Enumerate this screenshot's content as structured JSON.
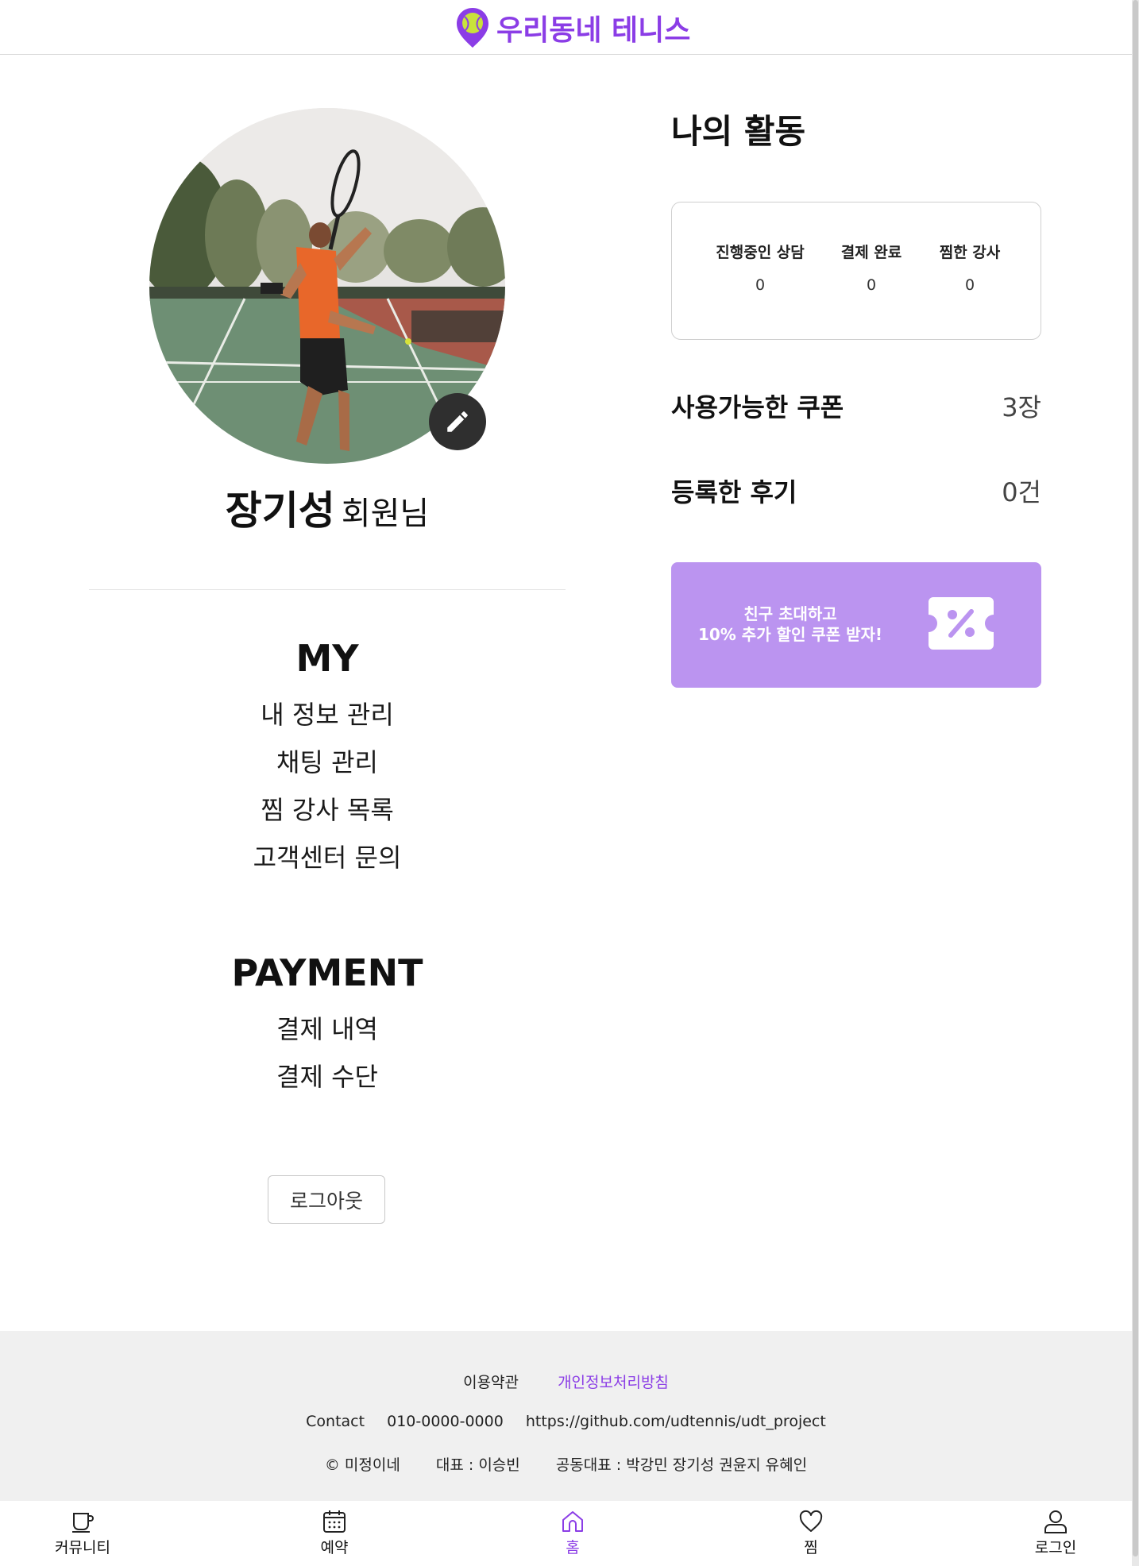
{
  "header": {
    "logo_text": "우리동네 테니스"
  },
  "profile": {
    "name": "장기성",
    "suffix": "회원님",
    "edit_icon": "pencil-icon"
  },
  "my_menu": {
    "title": "MY",
    "items": [
      "내 정보 관리",
      "채팅 관리",
      "찜 강사 목록",
      "고객센터 문의"
    ]
  },
  "payment_menu": {
    "title": "PAYMENT",
    "items": [
      "결제 내역",
      "결제 수단"
    ]
  },
  "logout_label": "로그아웃",
  "activity": {
    "title": "나의 활동",
    "stats": [
      {
        "label": "진행중인 상담",
        "value": "0"
      },
      {
        "label": "결제 완료",
        "value": "0"
      },
      {
        "label": "찜한 강사",
        "value": "0"
      }
    ],
    "coupon_label": "사용가능한 쿠폰",
    "coupon_value": "3장",
    "review_label": "등록한 후기",
    "review_value": "0건"
  },
  "promo": {
    "line1": "친구 초대하고",
    "line2": "10% 추가 할인 쿠폰 받자!",
    "icon": "discount-ticket-icon"
  },
  "footer": {
    "terms": "이용약관",
    "privacy": "개인정보처리방침",
    "contact_label": "Contact",
    "phone": "010-0000-0000",
    "github": "https://github.com/udtennis/udt_project",
    "copyright": "© 미정이네",
    "ceo": "대표 : 이승빈",
    "co_ceo": "공동대표 : 박강민 장기성 권윤지 유혜인"
  },
  "nav": [
    {
      "label": "커뮤니티",
      "icon": "cup-icon"
    },
    {
      "label": "예약",
      "icon": "calendar-icon"
    },
    {
      "label": "홈",
      "icon": "home-icon",
      "active": true
    },
    {
      "label": "찜",
      "icon": "heart-icon"
    },
    {
      "label": "로그인",
      "icon": "user-icon"
    }
  ],
  "colors": {
    "brand": "#8b3de6",
    "promo_bg": "#bb94f0",
    "footer_bg": "#f0f0f0"
  }
}
